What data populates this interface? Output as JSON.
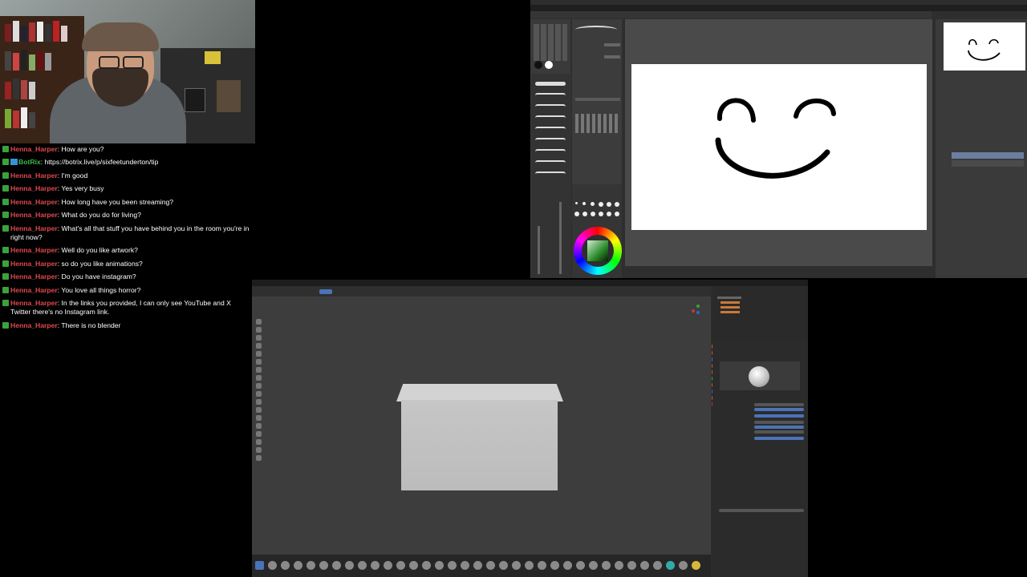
{
  "chat": {
    "messages": [
      {
        "user": "Henna_Harper",
        "text": "How are you?",
        "bot": false
      },
      {
        "user": "BotRix",
        "text": "https://botrix.live/p/sixfeetunderton/tip",
        "bot": true
      },
      {
        "user": "Henna_Harper",
        "text": "I'm good",
        "bot": false
      },
      {
        "user": "Henna_Harper",
        "text": "Yes very busy",
        "bot": false
      },
      {
        "user": "Henna_Harper",
        "text": "How long have you been streaming?",
        "bot": false
      },
      {
        "user": "Henna_Harper",
        "text": "What do you do for living?",
        "bot": false
      },
      {
        "user": "Henna_Harper",
        "text": "What's all that stuff you have behind you in the room you're in right now?",
        "bot": false
      },
      {
        "user": "Henna_Harper",
        "text": "Well do you like artwork?",
        "bot": false
      },
      {
        "user": "Henna_Harper",
        "text": "so do you like animations?",
        "bot": false
      },
      {
        "user": "Henna_Harper",
        "text": "Do you have instagram?",
        "bot": false
      },
      {
        "user": "Henna_Harper",
        "text": "You love all things horror?",
        "bot": false
      },
      {
        "user": "Henna_Harper",
        "text": "In the links you provided, I can only see YouTube and X Twitter there's no Instagram link.",
        "bot": false
      },
      {
        "user": "Henna_Harper",
        "text": "There is no blender",
        "bot": false
      }
    ]
  },
  "colors": {
    "chat_user": "#e0484f",
    "bot_user": "#3eb84a",
    "badge": "#3aa23a"
  },
  "icons": {
    "chat_badge": "moderator-badge-icon",
    "bot_badges": "verified-badge-icon"
  }
}
